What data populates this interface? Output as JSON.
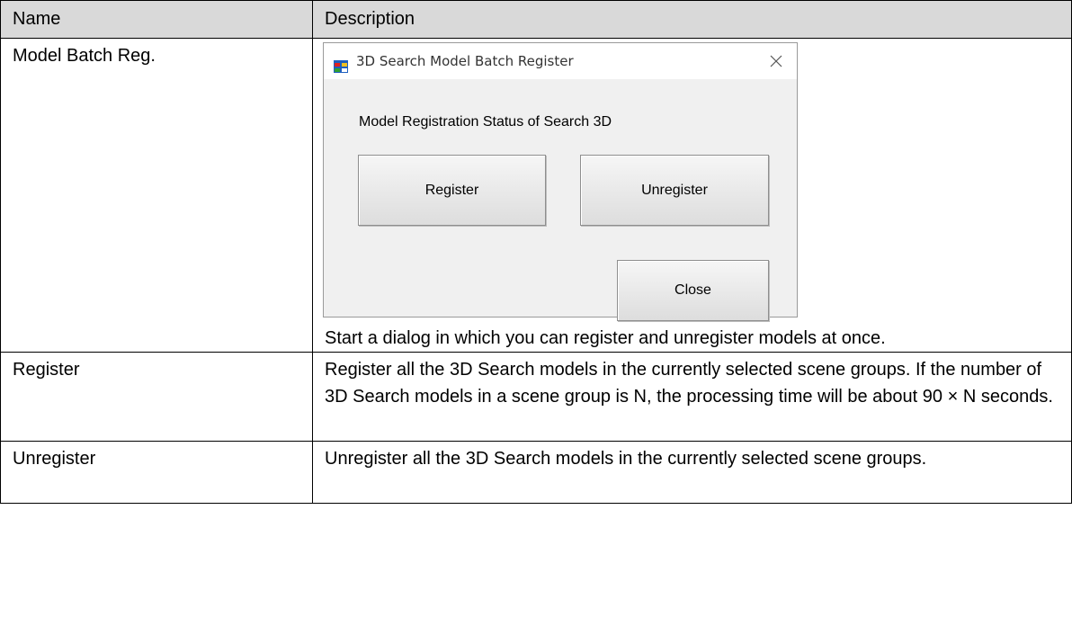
{
  "table": {
    "headers": {
      "name": "Name",
      "description": "Description"
    },
    "rows": [
      {
        "name": "Model Batch Reg.",
        "description": "Start a dialog in which you can register and unregister models at once."
      },
      {
        "name": "Register",
        "description": "Register all the 3D Search models in the currently selected scene groups. If the number of 3D Search models in a scene group is N, the processing time will be about 90 × N seconds."
      },
      {
        "name": "Unregister",
        "description": "Unregister all the 3D Search models in the currently selected scene groups."
      }
    ]
  },
  "dialog": {
    "title": "3D Search Model Batch Register",
    "status_label": "Model Registration Status of Search 3D",
    "register_label": "Register",
    "unregister_label": "Unregister",
    "close_label": "Close",
    "icons": {
      "app": "app-window-icon",
      "close": "close-x-icon"
    }
  },
  "colors": {
    "header_bg": "#d9d9d9",
    "dialog_bg": "#f0f0f0",
    "border": "#000000"
  }
}
